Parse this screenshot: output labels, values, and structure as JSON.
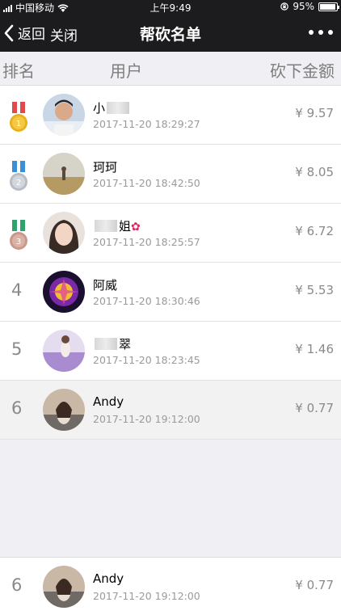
{
  "status_bar": {
    "carrier": "中国移动",
    "time": "上午9:49",
    "battery": "95%",
    "battery_level": 0.95
  },
  "nav": {
    "back_label": "返回",
    "close_label": "关闭",
    "title": "帮砍名单"
  },
  "table_header": {
    "rank": "排名",
    "user": "用户",
    "amount": "砍下金额"
  },
  "rows": [
    {
      "rank": "1",
      "medal": "gold",
      "name": "小",
      "name_suffix": "",
      "time": "2017-11-20 18:29:27",
      "amount": "¥ 9.57"
    },
    {
      "rank": "2",
      "medal": "silver",
      "name": "珂珂",
      "name_suffix": "",
      "time": "2017-11-20 18:42:50",
      "amount": "¥ 8.05"
    },
    {
      "rank": "3",
      "medal": "bronze",
      "name": "",
      "name_suffix": "姐",
      "time": "2017-11-20 18:25:57",
      "amount": "¥ 6.72"
    },
    {
      "rank": "4",
      "name": "阿威",
      "time": "2017-11-20 18:30:46",
      "amount": "¥ 5.53"
    },
    {
      "rank": "5",
      "name": "",
      "name_suffix": "翠",
      "time": "2017-11-20 18:23:45",
      "amount": "¥ 1.46"
    },
    {
      "rank": "6",
      "name": "Andy",
      "time": "2017-11-20 19:12:00",
      "amount": "¥ 0.77"
    }
  ],
  "my_row": {
    "rank": "6",
    "name": "Andy",
    "time": "2017-11-20 19:12:00",
    "amount": "¥ 0.77"
  },
  "colors": {
    "nav_bg": "#1c1c1e",
    "gold": "#e8b21f",
    "silver": "#b8bcc4",
    "bronze": "#c9988a",
    "ribbon_red": "#e04a4a",
    "ribbon_blue": "#3a8fd6",
    "ribbon_green": "#2fa36b"
  }
}
